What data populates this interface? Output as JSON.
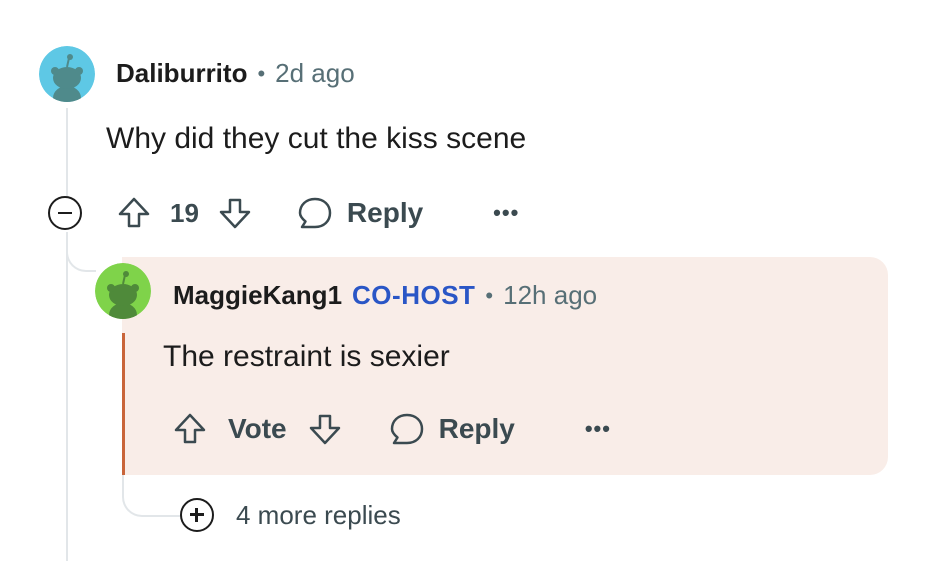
{
  "comment": {
    "username": "Daliburrito",
    "separator": "•",
    "time": "2d ago",
    "body": "Why did they cut the kiss scene",
    "votes": "19",
    "reply_label": "Reply",
    "more_label": "•••",
    "avatar_color": "#5ec8e5"
  },
  "reply": {
    "username": "MaggieKang1",
    "badge": "CO-HOST",
    "separator": "•",
    "time": "12h ago",
    "body": "The restraint is sexier",
    "vote_label": "Vote",
    "reply_label": "Reply",
    "more_label": "•••",
    "avatar_color": "#7fd34a",
    "background_color": "#f9ede8",
    "accent_color": "#c9653a"
  },
  "more_replies": {
    "label": "4 more replies"
  },
  "icons": {
    "upvote": "arrow-up-outline-icon",
    "downvote": "arrow-down-outline-icon",
    "reply": "speech-bubble-icon",
    "collapse": "minus-circle-icon",
    "expand": "plus-circle-icon"
  }
}
